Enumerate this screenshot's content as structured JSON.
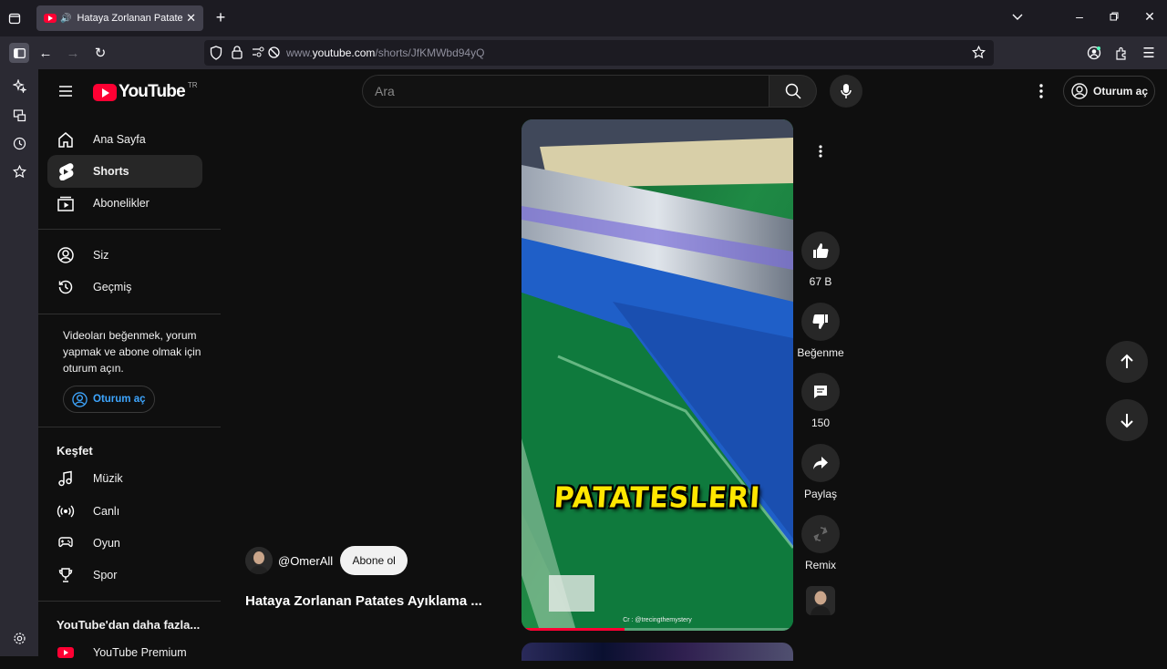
{
  "browser": {
    "tab_title": "Hataya Zorlanan Patates Ayıklama",
    "url_prefix": "www.",
    "url_domain": "youtube.com",
    "url_path": "/shorts/JfKMWbd94yQ"
  },
  "header": {
    "logo_text": "YouTube",
    "country_code": "TR",
    "search_placeholder": "Ara",
    "signin_label": "Oturum aç"
  },
  "sidebar": {
    "items": [
      {
        "label": "Ana Sayfa"
      },
      {
        "label": "Shorts"
      },
      {
        "label": "Abonelikler"
      },
      {
        "label": "Siz"
      },
      {
        "label": "Geçmiş"
      }
    ],
    "signin_note": "Videoları beğenmek, yorum yapmak ve abone olmak için oturum açın.",
    "signin_label": "Oturum aç",
    "explore_title": "Keşfet",
    "explore_items": [
      {
        "label": "Müzik"
      },
      {
        "label": "Canlı"
      },
      {
        "label": "Oyun"
      },
      {
        "label": "Spor"
      }
    ],
    "more_title": "YouTube'dan daha fazla...",
    "premium_label": "YouTube Premium"
  },
  "short": {
    "caption": "PATATESLERI",
    "credit": "Cr : @trecingthemystery",
    "channel_handle": "@OmerAll",
    "subscribe_label": "Abone ol",
    "title": "Hataya Zorlanan Patates Ayıklama ...",
    "progress": 0.38
  },
  "actions": {
    "likes": "67 B",
    "dislike_label": "Beğenme",
    "comments": "150",
    "share_label": "Paylaş",
    "remix_label": "Remix"
  },
  "colors": {
    "accent_red": "#ff0033",
    "link_blue": "#3ea6ff",
    "caption_yellow": "#ffe600"
  }
}
